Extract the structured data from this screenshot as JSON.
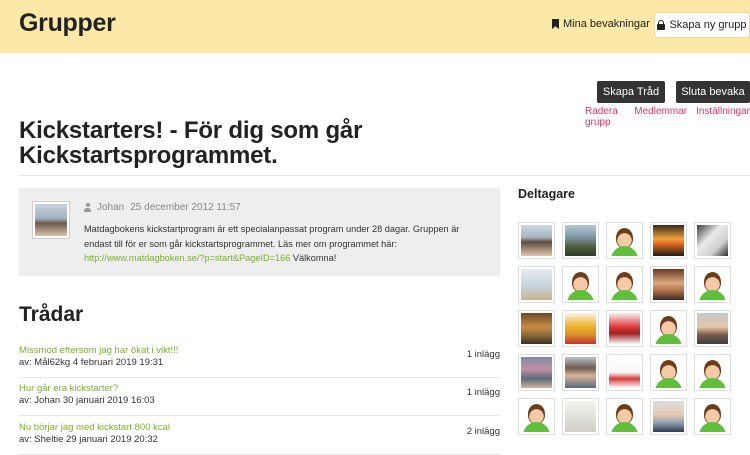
{
  "header": {
    "title": "Grupper",
    "watch_label": "Mina bevakningar",
    "create_group_label": "Skapa ny grupp"
  },
  "actions": {
    "create_thread": "Skapa Tråd",
    "stop_watching": "Sluta bevaka",
    "admin_links": [
      "Radera grupp",
      "Medlemmar",
      "Inställningar"
    ]
  },
  "group": {
    "title": "Kickstarters! - För dig som går Kickstartsprogrammet."
  },
  "post": {
    "author": "Johan",
    "date": "25 december 2012 11:57",
    "text_before": "Matdagbokens kickstartprogram är ett specialanpassat program under 28 dagar. Gruppen är endast till för er som går kickstartsprogrammet. Läs mer om programmet här: ",
    "link": "http://www.matdagboken.se/?p=start&PageID=166",
    "text_after": " Välkomna!"
  },
  "threads": {
    "heading": "Trådar",
    "items": [
      {
        "title": "Missmod eftersom jag har ökat i vikt!!!",
        "sub": "av: Mål62kg 4 februari 2019 19:31",
        "count": "1 inlägg"
      },
      {
        "title": "Hur går era kickstarter?",
        "sub": "av: Johan 30 januari 2019 16:03",
        "count": "1 inlägg"
      },
      {
        "title": "Nu börjar jag med kickstart 800 kcal",
        "sub": "av: Sheltie 29 januari 2019 20:32",
        "count": "2 inlägg"
      }
    ]
  },
  "participants": {
    "heading": "Deltagare",
    "avatars": [
      "photo-man",
      "photo-outdoor",
      "default-avatar",
      "photo-sunset",
      "photo-dog",
      "photo-beach",
      "default-avatar",
      "default-avatar",
      "photo-woman",
      "default-avatar",
      "photo-house",
      "photo-pooh",
      "photo-flowers",
      "default-avatar",
      "photo-man-glasses",
      "photo-person-2",
      "photo-woman-2",
      "photo-drawing",
      "default-avatar",
      "default-avatar",
      "default-avatar",
      "photo-wall",
      "default-avatar",
      "photo-man-2",
      "default-avatar"
    ]
  }
}
